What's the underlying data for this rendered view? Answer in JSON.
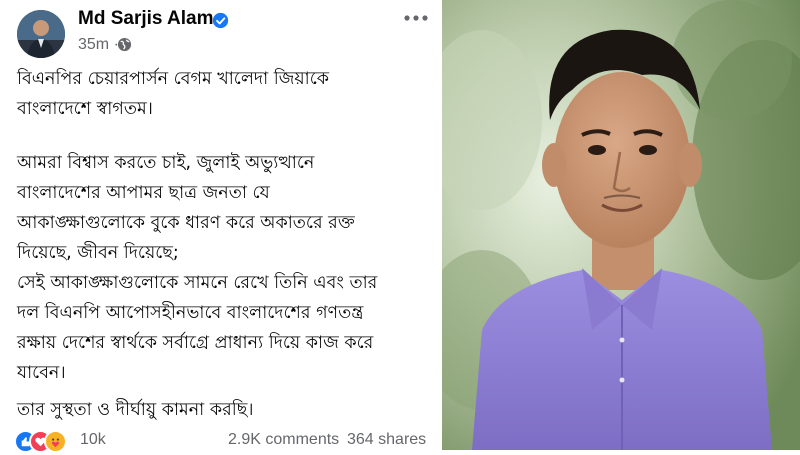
{
  "post": {
    "author": "Md Sarjis Alam",
    "time": "35m",
    "paragraphs": [
      [
        "বিএনপির চেয়ারপার্সন বেগম খালেদা জিয়াকে",
        "বাংলাদেশে স্বাগতম।"
      ],
      [
        "আমরা বিশ্বাস করতে চাই, জুলাই অভ্যুত্থানে",
        "বাংলাদেশের আপামর ছাত্র জনতা যে",
        "আকাঙ্ক্ষাগুলোকে বুকে ধারণ করে অকাতরে রক্ত",
        "দিয়েছে, জীবন দিয়েছে;",
        "সেই আকাঙ্ক্ষাগুলোকে সামনে রেখে তিনি এবং তার",
        "দল বিএনপি আপোসহীনভাবে বাংলাদেশের গণতন্ত্র",
        "রক্ষায় দেশের স্বার্থকে সর্বাগ্রে প্রাধান্য দিয়ে কাজ করে",
        "যাবেন।"
      ],
      [
        "তার সুস্থতা ও দীর্ঘায়ু কামনা করছি।"
      ]
    ],
    "reactions_count": "10k",
    "comments": "2.9K comments",
    "shares": "364 shares",
    "reaction_icons": [
      "like-icon",
      "love-icon",
      "care-icon"
    ]
  },
  "colors": {
    "text": "#050505",
    "secondary": "#65676b",
    "verified": "#1877f2",
    "shirt": "#8f7fd1"
  }
}
